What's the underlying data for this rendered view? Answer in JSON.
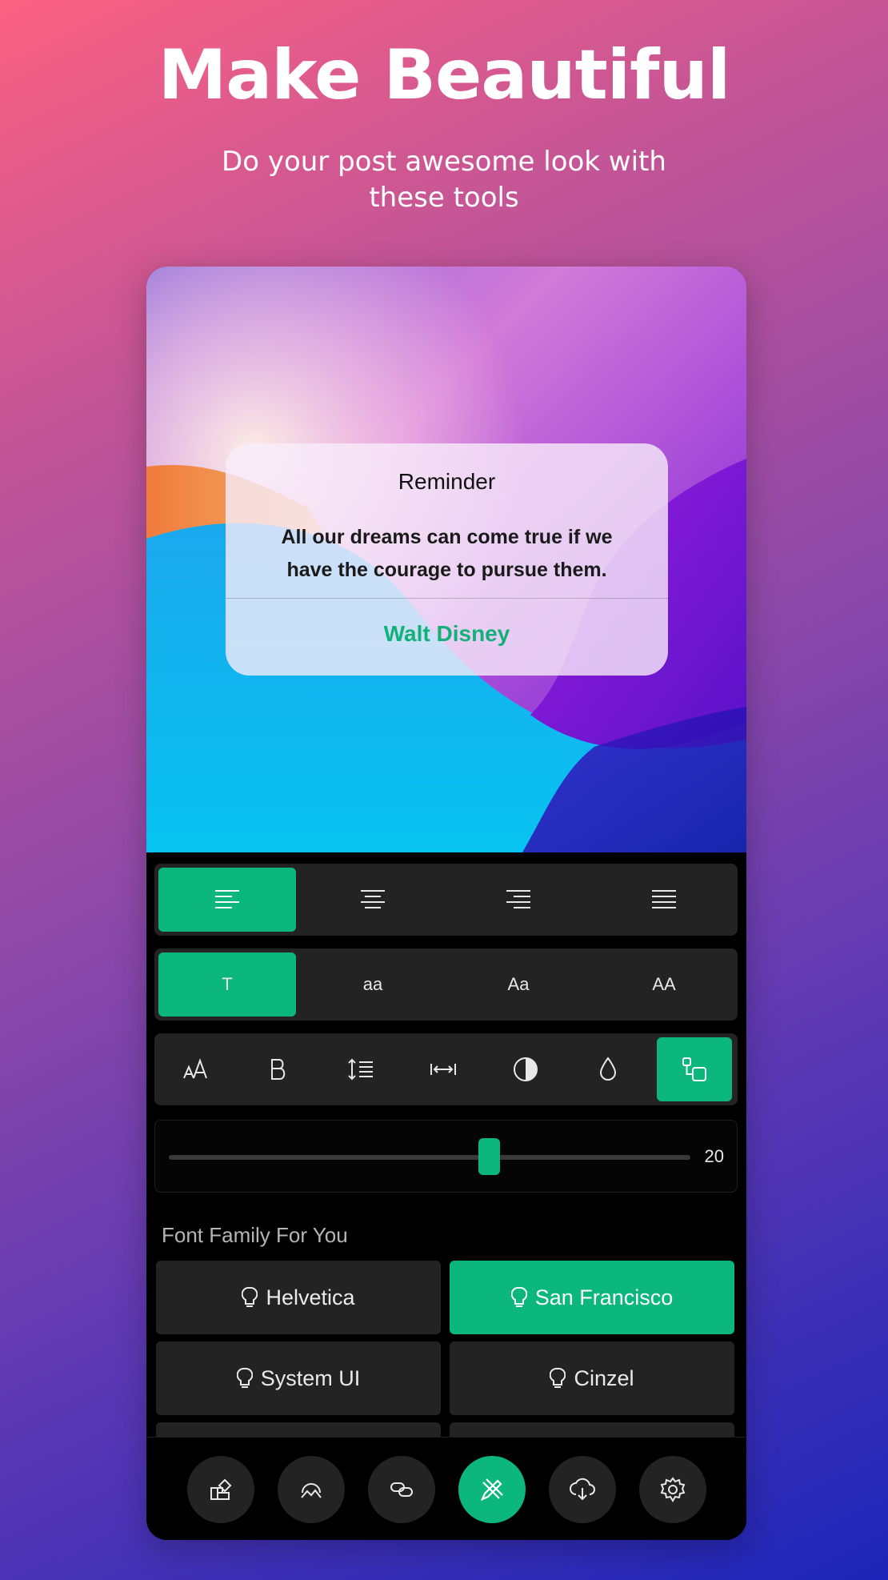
{
  "header": {
    "title": "Make Beautiful",
    "subtitle": "Do your post awesome look with these tools"
  },
  "quote_card": {
    "title": "Reminder",
    "body": "All our dreams can come true if we have the courage to pursue them.",
    "author": "Walt Disney"
  },
  "alignment": {
    "options": [
      "align-left-icon",
      "align-center-icon",
      "align-right-icon",
      "align-justify-icon"
    ],
    "selected": 0
  },
  "text_case": {
    "options": [
      "T",
      "aa",
      "Aa",
      "AA"
    ],
    "selected": 0
  },
  "tools": {
    "items": [
      "font-size-icon",
      "bold-icon",
      "line-height-icon",
      "letter-spacing-icon",
      "contrast-icon",
      "color-drop-icon",
      "position-icon"
    ],
    "selected": 6
  },
  "slider": {
    "value": "20",
    "fraction": 0.615
  },
  "font_family": {
    "label": "Font Family For You",
    "fonts": [
      "Helvetica",
      "San Francisco",
      "System UI",
      "Cinzel"
    ],
    "selected": 1
  },
  "bottom_nav": {
    "items": [
      "templates-icon",
      "background-image-icon",
      "link-icon",
      "edit-style-icon",
      "cloud-download-icon",
      "settings-icon"
    ],
    "selected": 3
  },
  "colors": {
    "accent": "#0bb77c",
    "panel": "#232323",
    "author": "#14b07a"
  }
}
